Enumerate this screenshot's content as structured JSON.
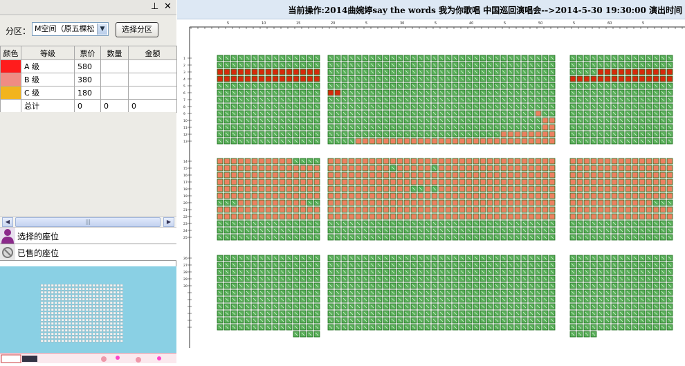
{
  "pane": {
    "pin_icon": "⊥",
    "close_icon": "✕"
  },
  "zone": {
    "label": "分区：",
    "selected": "M空间（原五棵松",
    "button": "选择分区"
  },
  "table": {
    "headers": [
      "颜色",
      "等级",
      "票价",
      "数量",
      "金额"
    ],
    "rows": [
      {
        "color": "#ff1c1c",
        "grade": "A 级",
        "price": "580",
        "qty": "",
        "amount": ""
      },
      {
        "color": "#f08c83",
        "grade": "B 级",
        "price": "380",
        "qty": "",
        "amount": ""
      },
      {
        "color": "#f2b41e",
        "grade": "C 级",
        "price": "180",
        "qty": "",
        "amount": ""
      }
    ],
    "total": {
      "grade": "总计",
      "price": "0",
      "qty": "0",
      "amount": "0"
    }
  },
  "legend": {
    "selected": "选择的座位",
    "sold": "已售的座位"
  },
  "status": {
    "text": "当前操作:2014曲婉婷say the words 我为你歌唱 中国巡回演唱会-->2014-5-30 19:30:00  演出时间"
  },
  "ruler_top": [
    "5",
    "10",
    "15",
    "20",
    "5",
    "30",
    "5",
    "40",
    "5",
    "50",
    "5",
    "60",
    "5"
  ],
  "row_labels": [
    "1",
    "2",
    "3",
    "4",
    "5",
    "6",
    "7",
    "8",
    "9",
    "10",
    "11",
    "12",
    "13",
    "14",
    "15",
    "16",
    "17",
    "18",
    "19",
    "20",
    "21",
    "22",
    "23",
    "24",
    "25",
    "26",
    "27",
    "28",
    "29",
    "30"
  ],
  "colors": {
    "available": "#5bb05b",
    "available_border": "#1f6e1f",
    "b_grade": "#ec8060",
    "a_grade": "#d52a0c"
  }
}
